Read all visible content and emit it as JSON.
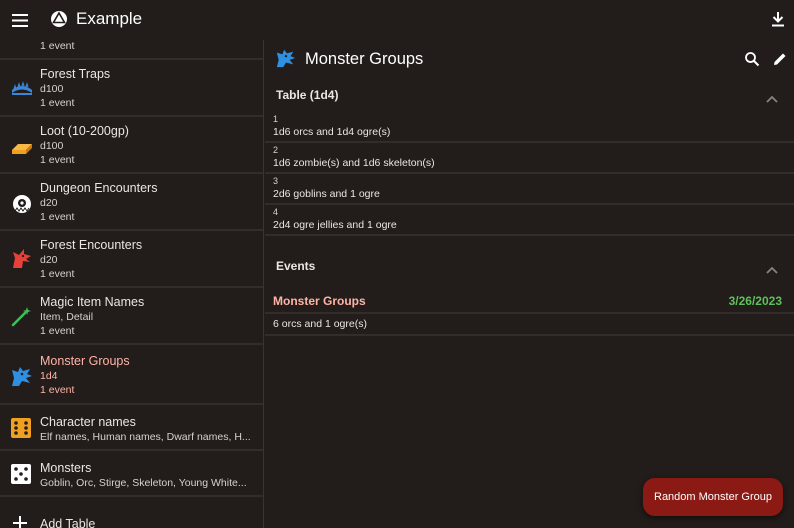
{
  "app": {
    "title": "Example"
  },
  "sidebar": {
    "top_partial": "1 event",
    "items": [
      {
        "name": "Forest Traps",
        "sub1": "d100",
        "sub2": "1 event",
        "icon": "trap-icon",
        "color": "#3a86d8"
      },
      {
        "name": "Loot (10-200gp)",
        "sub1": "d100",
        "sub2": "1 event",
        "icon": "gold-bar-icon",
        "color": "#f0a020"
      },
      {
        "name": "Dungeon Encounters",
        "sub1": "d20",
        "sub2": "1 event",
        "icon": "beholder-icon",
        "color": "#ffffff"
      },
      {
        "name": "Forest Encounters",
        "sub1": "d20",
        "sub2": "1 event",
        "icon": "dragon-head-icon",
        "color": "#e8413a"
      },
      {
        "name": "Magic Item Names",
        "sub1": "Item, Detail",
        "sub2": "1 event",
        "icon": "magic-wand-icon",
        "color": "#3cc05a"
      },
      {
        "name": "Monster Groups",
        "sub1": "1d4",
        "sub2": "1 event",
        "icon": "monster-icon",
        "color": "#2f8fe0",
        "selected": true
      },
      {
        "name": "Character names",
        "sub1": "Elf names, Human names, Dwarf names, H...",
        "icon": "dice-icon",
        "color": "#f0a020"
      },
      {
        "name": "Monsters",
        "sub1": "Goblin, Orc, Stirge, Skeleton, Young White...",
        "icon": "dice-icon",
        "color": "#ffffff"
      }
    ],
    "add_table": "Add Table"
  },
  "main": {
    "title": "Monster Groups",
    "table_section": "Table (1d4)",
    "rows": [
      {
        "num": "1",
        "value": "1d6 orcs and 1d4 ogre(s)"
      },
      {
        "num": "2",
        "value": "1d6 zombie(s) and 1d6 skeleton(s)"
      },
      {
        "num": "3",
        "value": "2d6 goblins and 1 ogre"
      },
      {
        "num": "4",
        "value": "2d4 ogre jellies and 1 ogre"
      }
    ],
    "events_section": "Events",
    "event": {
      "name": "Monster Groups",
      "date": "3/26/2023",
      "result": "6 orcs and 1 ogre(s)"
    }
  },
  "fab": {
    "label": "Random Monster Group"
  }
}
